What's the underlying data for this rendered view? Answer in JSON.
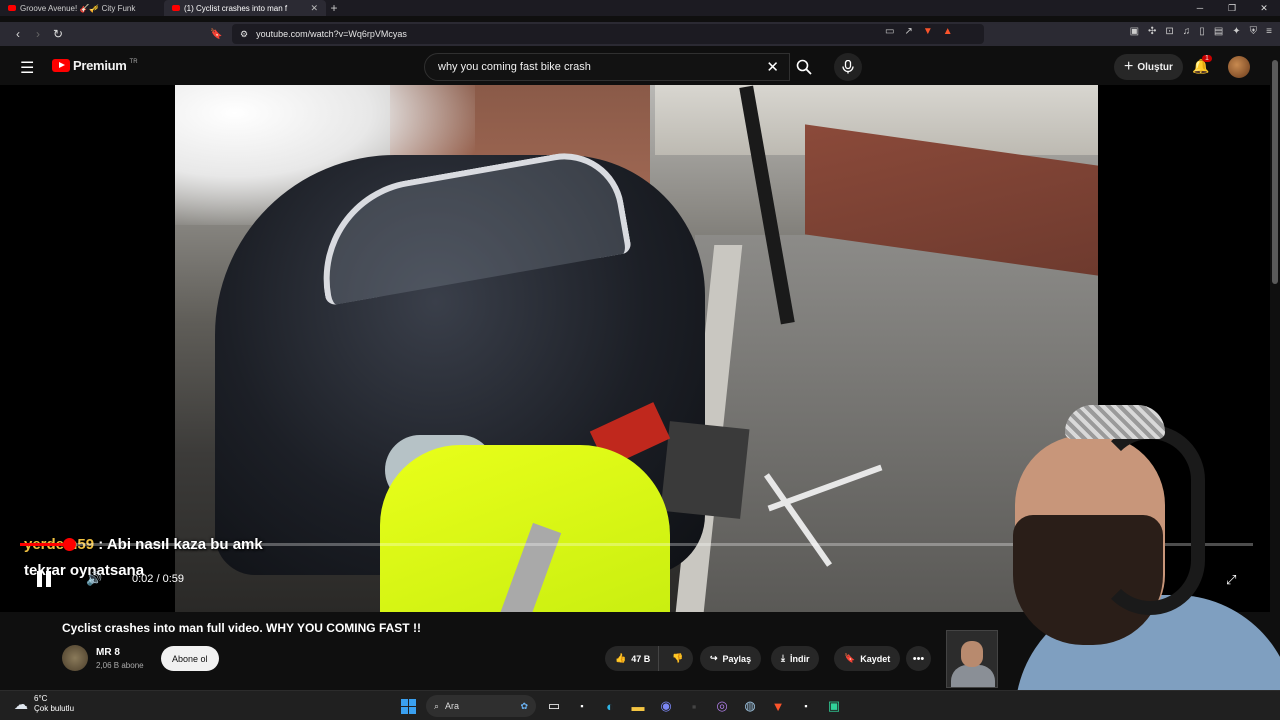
{
  "browser": {
    "tabs": [
      {
        "label": "Groove Avenue! 🎸🎺 City Funk"
      },
      {
        "label": "(1) Cyclist crashes into man f"
      }
    ],
    "new_tab_symbol": "+",
    "url": "youtube.com/watch?v=Wq6rpVMcyas"
  },
  "youtube": {
    "logo_word": "Premium",
    "logo_region": "TR",
    "search_query": "why you coming fast bike crash",
    "create_label": "Oluştur",
    "notification_count": "1"
  },
  "player": {
    "chat_user": "yerdem59",
    "chat_message": " : Abi nasıl kaza bu amk tekrar oynatsana",
    "time_display": "0:02 / 0:59",
    "progress_fraction": 0.04
  },
  "video_info": {
    "title": "Cyclist crashes into man full video. WHY YOU COMING FAST !!",
    "channel_name": "MR 8",
    "subscribers": "2,06 B abone",
    "subscribe_label": "Abone ol",
    "like_count": "47 B",
    "share_label": "Paylaş",
    "download_label": "İndir",
    "save_label": "Kaydet",
    "more_symbol": "•••"
  },
  "taskbar": {
    "temperature": "6°C",
    "condition": "Çok bulutlu",
    "search_label": "Ara"
  },
  "colors": {
    "accent": "#ff0000",
    "background": "#0f0f0f",
    "chat_username": "#f0c040"
  },
  "icons": [
    "hamburger-icon",
    "youtube-logo-icon",
    "search-icon",
    "mic-icon",
    "bell-icon",
    "pause-icon",
    "volume-icon",
    "fullscreen-icon",
    "like-icon",
    "dislike-icon",
    "share-icon",
    "download-icon",
    "bookmark-icon",
    "windows-icon",
    "weather-icon"
  ]
}
